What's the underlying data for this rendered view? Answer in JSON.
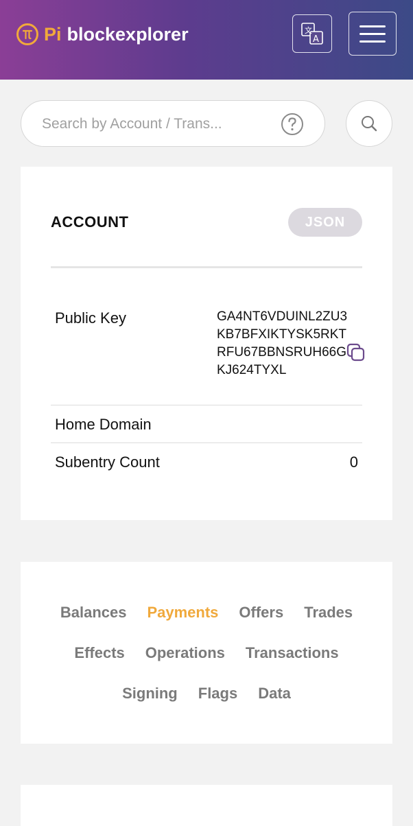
{
  "header": {
    "logo_pi": "Pi",
    "logo_text": "blockexplorer"
  },
  "search": {
    "placeholder": "Search by Account / Trans..."
  },
  "account": {
    "title": "ACCOUNT",
    "json_label": "JSON",
    "public_key_label": "Public Key",
    "public_key_value": "GA4NT6VDUINL2ZU3KB7BFXIKTYSK5RKTRFU67BBNSRUH66GKJ624TYXL",
    "home_domain_label": "Home Domain",
    "home_domain_value": "",
    "subentry_label": "Subentry Count",
    "subentry_value": "0"
  },
  "tabs": {
    "rows": [
      [
        "Balances",
        "Payments",
        "Offers",
        "Trades"
      ],
      [
        "Effects",
        "Operations",
        "Transactions"
      ],
      [
        "Signing",
        "Flags",
        "Data"
      ]
    ],
    "active": "Payments"
  },
  "colors": {
    "accent": "#f0a93c",
    "header_start": "#8b3e96",
    "header_end": "#3c4a87",
    "copy_icon": "#6b4a8c"
  },
  "icons": {
    "logo": "pi-logo-icon",
    "language": "translate-icon",
    "menu": "hamburger-menu-icon",
    "help": "question-circle-icon",
    "search": "search-icon",
    "copy": "copy-icon"
  }
}
